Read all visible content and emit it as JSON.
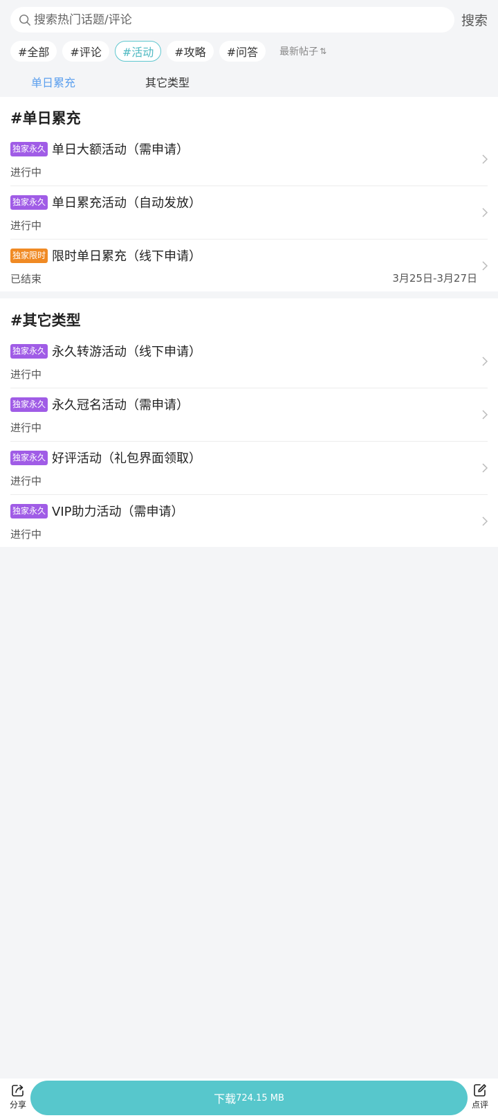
{
  "search": {
    "placeholder": "搜索热门话题/评论",
    "button_label": "搜索"
  },
  "tags": [
    {
      "label": "#全部",
      "active": false
    },
    {
      "label": "#评论",
      "active": false
    },
    {
      "label": "#活动",
      "active": true
    },
    {
      "label": "#攻略",
      "active": false
    },
    {
      "label": "#问答",
      "active": false
    }
  ],
  "sort": {
    "label": "最新帖子",
    "icon": "sort-arrows-icon"
  },
  "sub_tabs": [
    {
      "label": "单日累充",
      "active": true
    },
    {
      "label": "其它类型",
      "active": false
    }
  ],
  "colors": {
    "badge_permanent": "#a05ce6",
    "badge_limited": "#f08a24",
    "accent_teal": "#57c7cc",
    "tab_active": "#5b9fee"
  },
  "sections": [
    {
      "title": "#单日累充",
      "items": [
        {
          "badge": "独家永久",
          "badge_type": "permanent",
          "title": "单日大额活动（需申请）",
          "status": "进行中",
          "date": ""
        },
        {
          "badge": "独家永久",
          "badge_type": "permanent",
          "title": "单日累充活动（自动发放）",
          "status": "进行中",
          "date": ""
        },
        {
          "badge": "独家限时",
          "badge_type": "limited",
          "title": "限时单日累充（线下申请）",
          "status": "已结束",
          "date": "3月25日-3月27日"
        }
      ]
    },
    {
      "title": "#其它类型",
      "items": [
        {
          "badge": "独家永久",
          "badge_type": "permanent",
          "title": "永久转游活动（线下申请）",
          "status": "进行中",
          "date": ""
        },
        {
          "badge": "独家永久",
          "badge_type": "permanent",
          "title": "永久冠名活动（需申请）",
          "status": "进行中",
          "date": ""
        },
        {
          "badge": "独家永久",
          "badge_type": "permanent",
          "title": "好评活动（礼包界面领取）",
          "status": "进行中",
          "date": ""
        },
        {
          "badge": "独家永久",
          "badge_type": "permanent",
          "title": "VIP助力活动（需申请）",
          "status": "进行中",
          "date": ""
        }
      ]
    }
  ],
  "bottom_bar": {
    "share_label": "分享",
    "download_label": "下载",
    "download_size": "724.15 MB",
    "review_label": "点评"
  }
}
